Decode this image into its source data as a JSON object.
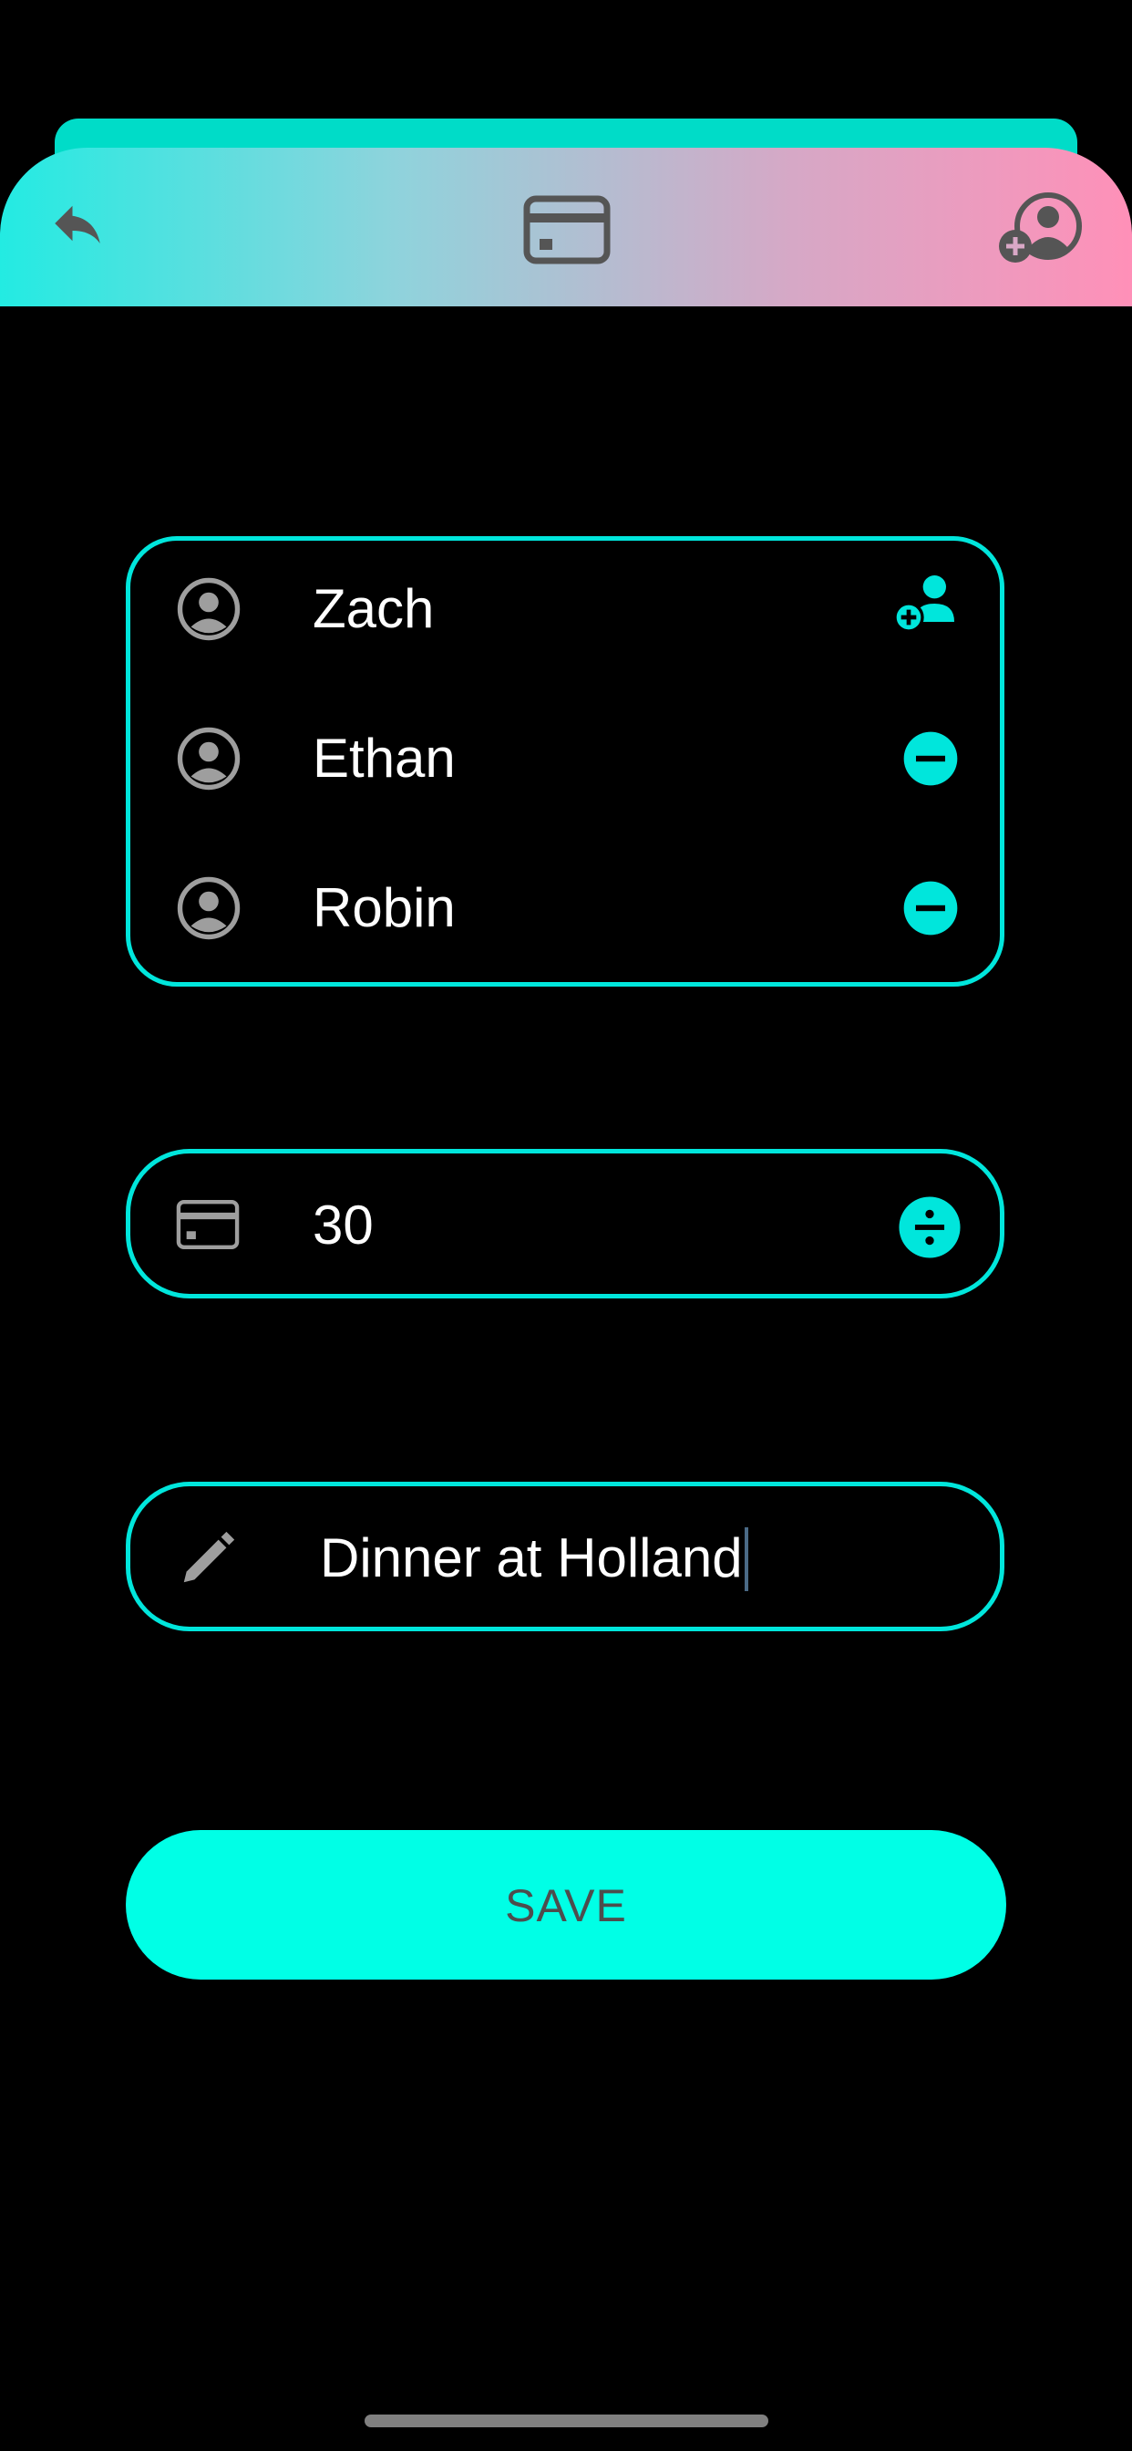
{
  "header": {
    "back_icon": "reply-arrow-icon",
    "center_icon": "credit-card-icon",
    "right_icon": "add-user-icon",
    "gradient_colors": [
      "#23ebe2",
      "#ff90b8"
    ]
  },
  "members": [
    {
      "name": "Zach",
      "action_icon": "add-user-icon"
    },
    {
      "name": "Ethan",
      "action_icon": "minus-circle-icon"
    },
    {
      "name": "Robin",
      "action_icon": "minus-circle-icon"
    }
  ],
  "amount": {
    "icon": "credit-card-icon",
    "value": "30",
    "action_icon": "divide-icon"
  },
  "note": {
    "icon": "pencil-icon",
    "value": "Dinner at Holland"
  },
  "save": {
    "label": "SAVE"
  },
  "colors": {
    "accent": "#00e6dc",
    "button": "#00ffe6",
    "background": "#000000"
  }
}
